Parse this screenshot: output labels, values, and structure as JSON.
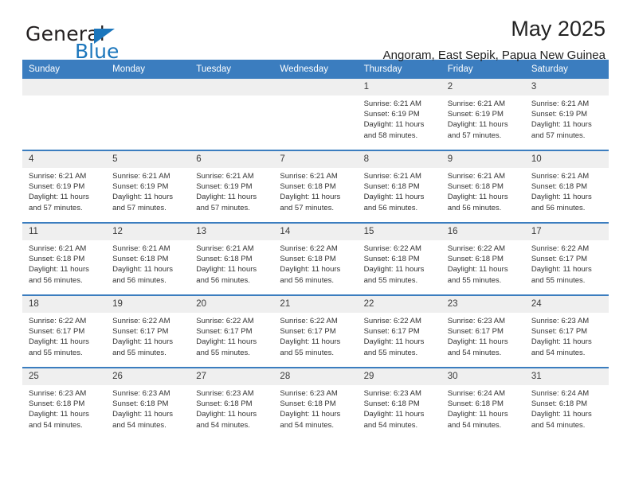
{
  "brand": {
    "name_dark": "General",
    "name_blue": "Blue",
    "logo_icon": "triangle-icon",
    "accent_color": "#1b76bc"
  },
  "header": {
    "title": "May 2025",
    "subtitle": "Angoram, East Sepik, Papua New Guinea"
  },
  "calendar": {
    "header_color": "#3b7dbf",
    "daynum_bg": "#efefef",
    "weekday_headers": [
      "Sunday",
      "Monday",
      "Tuesday",
      "Wednesday",
      "Thursday",
      "Friday",
      "Saturday"
    ],
    "labels": {
      "sunrise": "Sunrise:",
      "sunset": "Sunset:",
      "daylight": "Daylight:"
    },
    "weeks": [
      [
        {
          "day": "",
          "empty": true
        },
        {
          "day": "",
          "empty": true
        },
        {
          "day": "",
          "empty": true
        },
        {
          "day": "",
          "empty": true
        },
        {
          "day": "1",
          "sunrise": "Sunrise: 6:21 AM",
          "sunset": "Sunset: 6:19 PM",
          "daylight_line1": "Daylight: 11 hours",
          "daylight_line2": "and 58 minutes."
        },
        {
          "day": "2",
          "sunrise": "Sunrise: 6:21 AM",
          "sunset": "Sunset: 6:19 PM",
          "daylight_line1": "Daylight: 11 hours",
          "daylight_line2": "and 57 minutes."
        },
        {
          "day": "3",
          "sunrise": "Sunrise: 6:21 AM",
          "sunset": "Sunset: 6:19 PM",
          "daylight_line1": "Daylight: 11 hours",
          "daylight_line2": "and 57 minutes."
        }
      ],
      [
        {
          "day": "4",
          "sunrise": "Sunrise: 6:21 AM",
          "sunset": "Sunset: 6:19 PM",
          "daylight_line1": "Daylight: 11 hours",
          "daylight_line2": "and 57 minutes."
        },
        {
          "day": "5",
          "sunrise": "Sunrise: 6:21 AM",
          "sunset": "Sunset: 6:19 PM",
          "daylight_line1": "Daylight: 11 hours",
          "daylight_line2": "and 57 minutes."
        },
        {
          "day": "6",
          "sunrise": "Sunrise: 6:21 AM",
          "sunset": "Sunset: 6:19 PM",
          "daylight_line1": "Daylight: 11 hours",
          "daylight_line2": "and 57 minutes."
        },
        {
          "day": "7",
          "sunrise": "Sunrise: 6:21 AM",
          "sunset": "Sunset: 6:18 PM",
          "daylight_line1": "Daylight: 11 hours",
          "daylight_line2": "and 57 minutes."
        },
        {
          "day": "8",
          "sunrise": "Sunrise: 6:21 AM",
          "sunset": "Sunset: 6:18 PM",
          "daylight_line1": "Daylight: 11 hours",
          "daylight_line2": "and 56 minutes."
        },
        {
          "day": "9",
          "sunrise": "Sunrise: 6:21 AM",
          "sunset": "Sunset: 6:18 PM",
          "daylight_line1": "Daylight: 11 hours",
          "daylight_line2": "and 56 minutes."
        },
        {
          "day": "10",
          "sunrise": "Sunrise: 6:21 AM",
          "sunset": "Sunset: 6:18 PM",
          "daylight_line1": "Daylight: 11 hours",
          "daylight_line2": "and 56 minutes."
        }
      ],
      [
        {
          "day": "11",
          "sunrise": "Sunrise: 6:21 AM",
          "sunset": "Sunset: 6:18 PM",
          "daylight_line1": "Daylight: 11 hours",
          "daylight_line2": "and 56 minutes."
        },
        {
          "day": "12",
          "sunrise": "Sunrise: 6:21 AM",
          "sunset": "Sunset: 6:18 PM",
          "daylight_line1": "Daylight: 11 hours",
          "daylight_line2": "and 56 minutes."
        },
        {
          "day": "13",
          "sunrise": "Sunrise: 6:21 AM",
          "sunset": "Sunset: 6:18 PM",
          "daylight_line1": "Daylight: 11 hours",
          "daylight_line2": "and 56 minutes."
        },
        {
          "day": "14",
          "sunrise": "Sunrise: 6:22 AM",
          "sunset": "Sunset: 6:18 PM",
          "daylight_line1": "Daylight: 11 hours",
          "daylight_line2": "and 56 minutes."
        },
        {
          "day": "15",
          "sunrise": "Sunrise: 6:22 AM",
          "sunset": "Sunset: 6:18 PM",
          "daylight_line1": "Daylight: 11 hours",
          "daylight_line2": "and 55 minutes."
        },
        {
          "day": "16",
          "sunrise": "Sunrise: 6:22 AM",
          "sunset": "Sunset: 6:18 PM",
          "daylight_line1": "Daylight: 11 hours",
          "daylight_line2": "and 55 minutes."
        },
        {
          "day": "17",
          "sunrise": "Sunrise: 6:22 AM",
          "sunset": "Sunset: 6:17 PM",
          "daylight_line1": "Daylight: 11 hours",
          "daylight_line2": "and 55 minutes."
        }
      ],
      [
        {
          "day": "18",
          "sunrise": "Sunrise: 6:22 AM",
          "sunset": "Sunset: 6:17 PM",
          "daylight_line1": "Daylight: 11 hours",
          "daylight_line2": "and 55 minutes."
        },
        {
          "day": "19",
          "sunrise": "Sunrise: 6:22 AM",
          "sunset": "Sunset: 6:17 PM",
          "daylight_line1": "Daylight: 11 hours",
          "daylight_line2": "and 55 minutes."
        },
        {
          "day": "20",
          "sunrise": "Sunrise: 6:22 AM",
          "sunset": "Sunset: 6:17 PM",
          "daylight_line1": "Daylight: 11 hours",
          "daylight_line2": "and 55 minutes."
        },
        {
          "day": "21",
          "sunrise": "Sunrise: 6:22 AM",
          "sunset": "Sunset: 6:17 PM",
          "daylight_line1": "Daylight: 11 hours",
          "daylight_line2": "and 55 minutes."
        },
        {
          "day": "22",
          "sunrise": "Sunrise: 6:22 AM",
          "sunset": "Sunset: 6:17 PM",
          "daylight_line1": "Daylight: 11 hours",
          "daylight_line2": "and 55 minutes."
        },
        {
          "day": "23",
          "sunrise": "Sunrise: 6:23 AM",
          "sunset": "Sunset: 6:17 PM",
          "daylight_line1": "Daylight: 11 hours",
          "daylight_line2": "and 54 minutes."
        },
        {
          "day": "24",
          "sunrise": "Sunrise: 6:23 AM",
          "sunset": "Sunset: 6:17 PM",
          "daylight_line1": "Daylight: 11 hours",
          "daylight_line2": "and 54 minutes."
        }
      ],
      [
        {
          "day": "25",
          "sunrise": "Sunrise: 6:23 AM",
          "sunset": "Sunset: 6:18 PM",
          "daylight_line1": "Daylight: 11 hours",
          "daylight_line2": "and 54 minutes."
        },
        {
          "day": "26",
          "sunrise": "Sunrise: 6:23 AM",
          "sunset": "Sunset: 6:18 PM",
          "daylight_line1": "Daylight: 11 hours",
          "daylight_line2": "and 54 minutes."
        },
        {
          "day": "27",
          "sunrise": "Sunrise: 6:23 AM",
          "sunset": "Sunset: 6:18 PM",
          "daylight_line1": "Daylight: 11 hours",
          "daylight_line2": "and 54 minutes."
        },
        {
          "day": "28",
          "sunrise": "Sunrise: 6:23 AM",
          "sunset": "Sunset: 6:18 PM",
          "daylight_line1": "Daylight: 11 hours",
          "daylight_line2": "and 54 minutes."
        },
        {
          "day": "29",
          "sunrise": "Sunrise: 6:23 AM",
          "sunset": "Sunset: 6:18 PM",
          "daylight_line1": "Daylight: 11 hours",
          "daylight_line2": "and 54 minutes."
        },
        {
          "day": "30",
          "sunrise": "Sunrise: 6:24 AM",
          "sunset": "Sunset: 6:18 PM",
          "daylight_line1": "Daylight: 11 hours",
          "daylight_line2": "and 54 minutes."
        },
        {
          "day": "31",
          "sunrise": "Sunrise: 6:24 AM",
          "sunset": "Sunset: 6:18 PM",
          "daylight_line1": "Daylight: 11 hours",
          "daylight_line2": "and 54 minutes."
        }
      ]
    ]
  }
}
